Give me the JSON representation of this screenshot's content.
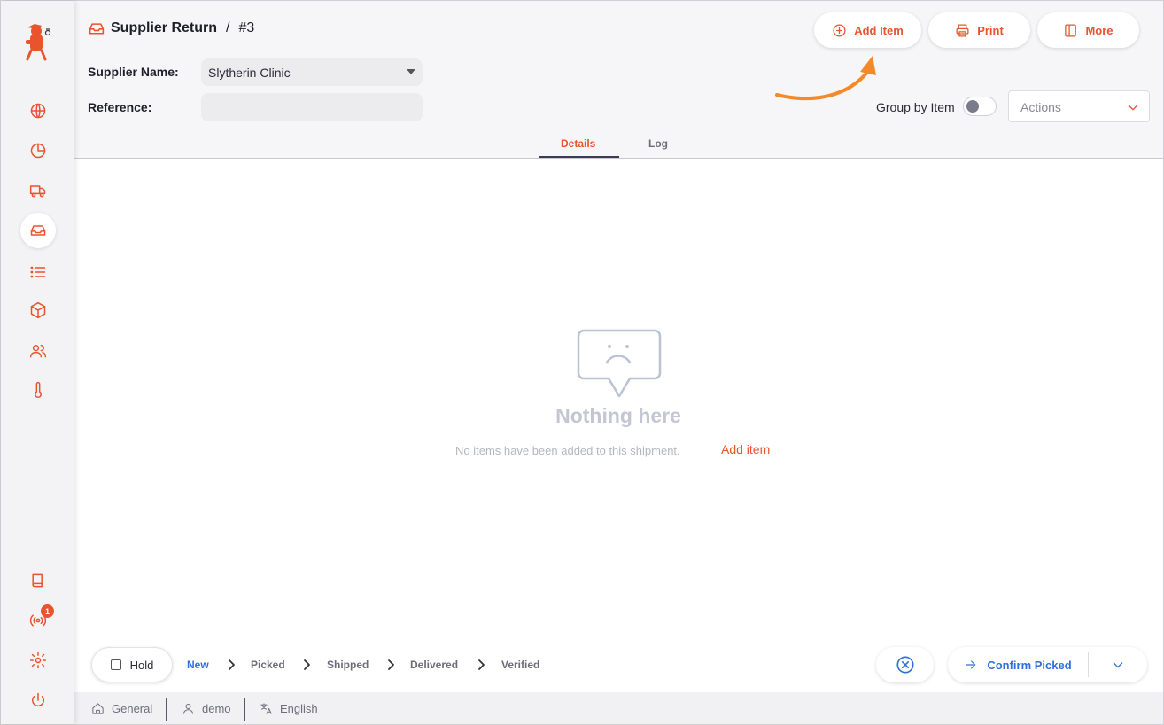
{
  "app": {
    "accent_color": "#e9532e",
    "link_color": "#2f6fdb"
  },
  "sidebar": {
    "logo": "mascot-logo",
    "items": [
      {
        "icon": "globe-icon"
      },
      {
        "icon": "pie-chart-icon"
      },
      {
        "icon": "truck-icon"
      },
      {
        "icon": "inbox-icon",
        "active": true
      },
      {
        "icon": "list-icon"
      },
      {
        "icon": "box-icon"
      },
      {
        "icon": "users-icon"
      },
      {
        "icon": "thermometer-icon"
      }
    ],
    "bottom_items": [
      {
        "icon": "book-icon"
      },
      {
        "icon": "broadcast-icon",
        "badge": "1"
      },
      {
        "icon": "gear-icon"
      },
      {
        "icon": "power-icon"
      }
    ]
  },
  "header": {
    "title": "Supplier Return",
    "separator": "/",
    "number": "#3",
    "supplier_label": "Supplier Name:",
    "supplier_value": "Slytherin Clinic",
    "reference_label": "Reference:",
    "reference_value": "",
    "buttons": {
      "add_item": "Add Item",
      "print": "Print",
      "more": "More"
    },
    "group_by_label": "Group by Item",
    "group_by_on": false,
    "actions_placeholder": "Actions",
    "tabs": [
      {
        "label": "Details",
        "active": true
      },
      {
        "label": "Log",
        "active": false
      }
    ]
  },
  "empty_state": {
    "title": "Nothing here",
    "message": "No items have been added to this shipment.",
    "link": "Add item"
  },
  "footer": {
    "hold_label": "Hold",
    "steps": [
      "New",
      "Picked",
      "Shipped",
      "Delivered",
      "Verified"
    ],
    "current_step": "New",
    "confirm_label": "Confirm Picked"
  },
  "statusbar": {
    "store": "General",
    "user": "demo",
    "language": "English"
  }
}
